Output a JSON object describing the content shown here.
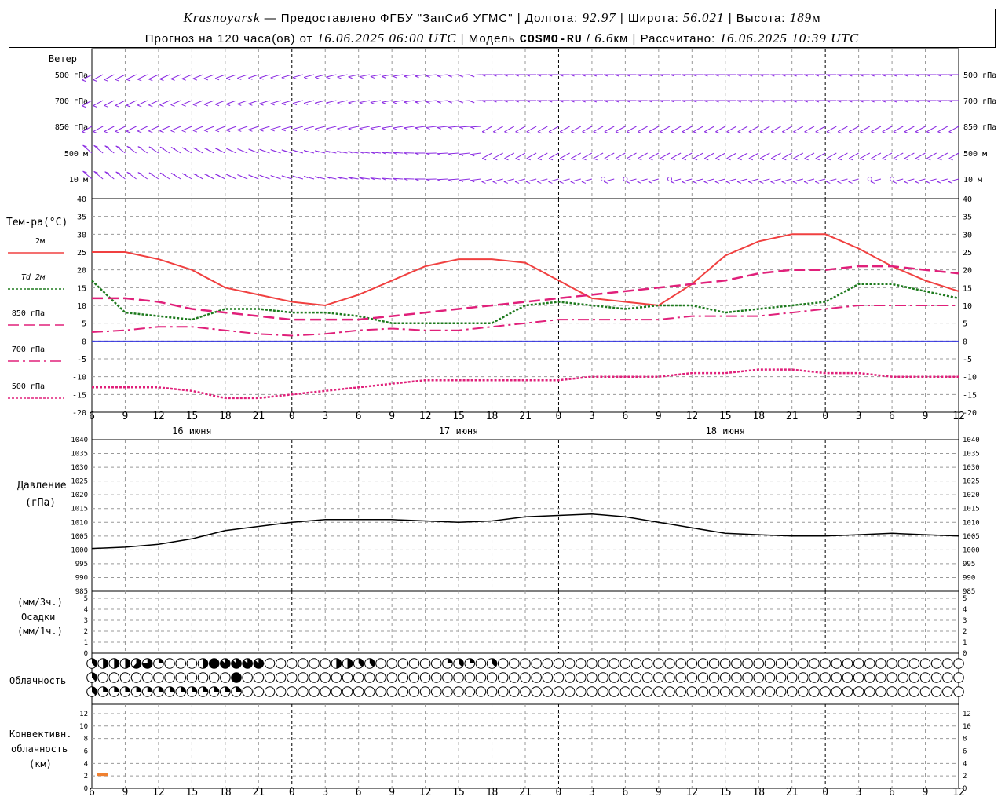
{
  "header": {
    "city": "Krasnoyarsk",
    "provider": " — Предоставлено ФГБУ \"ЗапСиб УГМС\"",
    "lon_label": "Долгота:",
    "lon": "92.97",
    "lat_label": "Широта:",
    "lat": "56.021",
    "alt_label": "Высота:",
    "alt": "189",
    "alt_unit": "м",
    "forecast_label": "Прогноз на 120 часа(ов) от",
    "forecast_start": "16.06.2025 06:00 UTC",
    "model_label": "Модель",
    "model": "COSMO-RU",
    "resolution": "6.6",
    "res_unit": "км",
    "computed_label": "Рассчитано:",
    "computed": "16.06.2025 10:39 UTC"
  },
  "labels": {
    "wind": "Ветер",
    "wind_levels": [
      "500 гПа",
      "700 гПа",
      "850 гПа",
      "500 м",
      "10 м"
    ],
    "temp_title": "Тем-ра(°С)",
    "pressure_title": "Давление",
    "pressure_unit": "(гПа)",
    "precip_unit1": "(мм/3ч.)",
    "precip_title": "Осадки",
    "precip_unit2": "(мм/1ч.)",
    "cloud_title": "Облачность",
    "conv_title1": "Конвективн.",
    "conv_title2": "облачность",
    "conv_unit": "(км)"
  },
  "legend": [
    {
      "label": "2м",
      "color": "#f04040",
      "style": "solid"
    },
    {
      "label": "Td 2м",
      "color": "#1e7a1e",
      "style": "dotted"
    },
    {
      "label": "850 гПа",
      "color": "#e0207a",
      "style": "dashed"
    },
    {
      "label": "700 гПа",
      "color": "#e0207a",
      "style": "dashdot"
    },
    {
      "label": "500 гПа",
      "color": "#e0207a",
      "style": "dotted"
    }
  ],
  "x_axis": {
    "tick_labels": [
      "6",
      "9",
      "12",
      "15",
      "18",
      "21",
      "0",
      "3",
      "6",
      "9",
      "12",
      "15",
      "18",
      "21",
      "0",
      "3",
      "6",
      "9",
      "12",
      "15",
      "18",
      "21",
      "0",
      "3",
      "6",
      "9",
      "12"
    ],
    "day_labels": [
      "16 июня",
      "17 июня",
      "18 июня"
    ]
  },
  "chart_data": [
    {
      "type": "line",
      "title": "Тем-ра(°С)",
      "x_unit": "hours since 16.06.2025 06:00 UTC",
      "x": [
        0,
        3,
        6,
        9,
        12,
        15,
        18,
        21,
        24,
        27,
        30,
        33,
        36,
        39,
        42,
        45,
        48,
        51,
        54,
        57,
        60,
        63,
        66,
        69,
        72,
        75,
        78
      ],
      "ylim": [
        -20,
        40
      ],
      "yticks": [
        -20,
        -15,
        -10,
        -5,
        0,
        5,
        10,
        15,
        20,
        25,
        30,
        35,
        40
      ],
      "series": [
        {
          "name": "2м",
          "values": [
            25,
            25,
            23,
            20,
            15,
            13,
            11,
            10,
            13,
            17,
            21,
            23,
            23,
            22,
            17,
            12,
            11,
            10,
            16,
            24,
            28,
            30,
            30,
            26,
            21,
            17,
            14
          ]
        },
        {
          "name": "Td 2м",
          "values": [
            17,
            8,
            7,
            6,
            9,
            9,
            8,
            8,
            7,
            5,
            5,
            5,
            5,
            10,
            11,
            10,
            9,
            10,
            10,
            8,
            9,
            10,
            11,
            16,
            16,
            14,
            12
          ]
        },
        {
          "name": "850 гПа",
          "values": [
            12,
            12,
            11,
            9,
            8,
            7,
            6,
            6,
            6,
            7,
            8,
            9,
            10,
            11,
            12,
            13,
            14,
            15,
            16,
            17,
            19,
            20,
            20,
            21,
            21,
            20,
            19
          ]
        },
        {
          "name": "700 гПа",
          "values": [
            2.5,
            3,
            4,
            4,
            3,
            2,
            1.5,
            2,
            3,
            3.5,
            3,
            3,
            4,
            5,
            6,
            6,
            6,
            6,
            7,
            7,
            7,
            8,
            9,
            10,
            10,
            10,
            10
          ]
        },
        {
          "name": "500 гПа",
          "values": [
            -13,
            -13,
            -13,
            -14,
            -16,
            -16,
            -15,
            -14,
            -13,
            -12,
            -11,
            -11,
            -11,
            -11,
            -11,
            -10,
            -10,
            -10,
            -9,
            -9,
            -8,
            -8,
            -9,
            -9,
            -10,
            -10,
            -10
          ]
        }
      ]
    },
    {
      "type": "line",
      "title": "Давление",
      "x": [
        0,
        3,
        6,
        9,
        12,
        15,
        18,
        21,
        24,
        27,
        30,
        33,
        36,
        39,
        42,
        45,
        48,
        51,
        54,
        57,
        60,
        63,
        66,
        69,
        72,
        75,
        78
      ],
      "ylim": [
        985,
        1040
      ],
      "yticks": [
        985,
        990,
        995,
        1000,
        1005,
        1010,
        1015,
        1020,
        1025,
        1030,
        1035,
        1040
      ],
      "series": [
        {
          "name": "pressure",
          "values": [
            1000.5,
            1001,
            1002,
            1004,
            1007,
            1008.5,
            1010,
            1011,
            1011,
            1011,
            1010.5,
            1010,
            1010.5,
            1012,
            1012.5,
            1013,
            1012,
            1010,
            1008,
            1006,
            1005.5,
            1005,
            1005,
            1005.5,
            1006,
            1005.5,
            1005
          ]
        }
      ]
    },
    {
      "type": "bar",
      "title": "Осадки",
      "ylim": [
        0,
        5
      ],
      "yticks": [
        0,
        1,
        2,
        3,
        4,
        5
      ],
      "values": []
    },
    {
      "type": "table",
      "title": "Облачность",
      "levels": [
        "upper",
        "middle",
        "lower"
      ],
      "x": [
        0,
        1,
        2,
        3,
        4,
        5,
        6,
        7,
        8,
        9,
        10,
        11,
        12,
        13,
        14,
        15,
        16,
        17,
        18,
        19,
        20,
        21,
        22,
        23,
        24,
        25,
        26,
        27,
        28,
        29,
        30,
        31,
        32,
        33,
        34,
        35,
        36,
        37,
        38,
        39,
        40,
        41,
        42,
        43,
        44,
        45,
        46,
        47,
        48,
        49,
        50,
        51,
        52,
        53,
        54,
        55,
        56,
        57,
        58,
        59,
        60,
        61,
        62,
        63,
        64,
        65,
        66,
        67,
        68,
        69,
        70,
        71,
        72,
        73,
        74,
        75,
        76,
        77,
        78
      ],
      "cover_eighths": {
        "upper": [
          3,
          4,
          4,
          4,
          5,
          6,
          2,
          0,
          0,
          0,
          4,
          8,
          7,
          7,
          7,
          7,
          0,
          0,
          0,
          0,
          0,
          0,
          4,
          4,
          3,
          3,
          0,
          0,
          0,
          0,
          0,
          0,
          2,
          3,
          2,
          0,
          3,
          0,
          0,
          0,
          0,
          0,
          0,
          0,
          0,
          0,
          0,
          0,
          0,
          0,
          0,
          0,
          0,
          0,
          0,
          0,
          0,
          0,
          0,
          0,
          0,
          0,
          0,
          0,
          0,
          0,
          0,
          0,
          0,
          0,
          0,
          0,
          0,
          0,
          0,
          0,
          0,
          0,
          0
        ],
        "middle": [
          3,
          0,
          0,
          0,
          0,
          0,
          0,
          0,
          0,
          0,
          0,
          0,
          0,
          8,
          0,
          0,
          0,
          0,
          0,
          0,
          0,
          0,
          0,
          0,
          0,
          0,
          0,
          0,
          0,
          0,
          0,
          0,
          0,
          0,
          0,
          0,
          0,
          0,
          0,
          0,
          0,
          0,
          0,
          0,
          0,
          0,
          0,
          0,
          0,
          0,
          0,
          0,
          0,
          0,
          0,
          0,
          0,
          0,
          0,
          0,
          0,
          0,
          0,
          0,
          0,
          0,
          0,
          0,
          0,
          0,
          0,
          0,
          0,
          0,
          0,
          0,
          0,
          0,
          0
        ],
        "lower": [
          3,
          2,
          2,
          2,
          2,
          2,
          2,
          2,
          2,
          2,
          2,
          2,
          2,
          2,
          0,
          0,
          0,
          0,
          0,
          0,
          0,
          0,
          0,
          0,
          0,
          0,
          0,
          0,
          0,
          0,
          0,
          0,
          0,
          0,
          0,
          0,
          0,
          0,
          0,
          0,
          0,
          0,
          0,
          0,
          0,
          0,
          0,
          0,
          0,
          0,
          0,
          0,
          0,
          0,
          0,
          0,
          0,
          0,
          0,
          0,
          0,
          0,
          0,
          0,
          0,
          0,
          0,
          0,
          0,
          0,
          0,
          0,
          0,
          0,
          0,
          0,
          0,
          0,
          0
        ]
      }
    },
    {
      "type": "bar",
      "title": "Конвективн. облачность",
      "ylim": [
        0,
        13
      ],
      "yticks": [
        0,
        2,
        4,
        6,
        8,
        10,
        12
      ],
      "bars": [
        {
          "x_from": 1,
          "x_to": 2,
          "base_km": 2,
          "top_km": 2.5
        }
      ]
    },
    {
      "type": "scatter",
      "title": "Ветер",
      "levels": [
        "500 гПа",
        "700 гПа",
        "850 гПа",
        "500 м",
        "10 м"
      ],
      "note": "wind barbs every hour per level"
    }
  ],
  "colors": {
    "t2m": "#f04040",
    "td2m": "#1e7a1e",
    "p850": "#e0207a",
    "p700": "#e0207a",
    "p500": "#e0207a",
    "wind": "#8a2be2",
    "pressure": "#000000",
    "zero_line": "#3030e0",
    "conv": "#f08030",
    "grid": "#999999"
  }
}
